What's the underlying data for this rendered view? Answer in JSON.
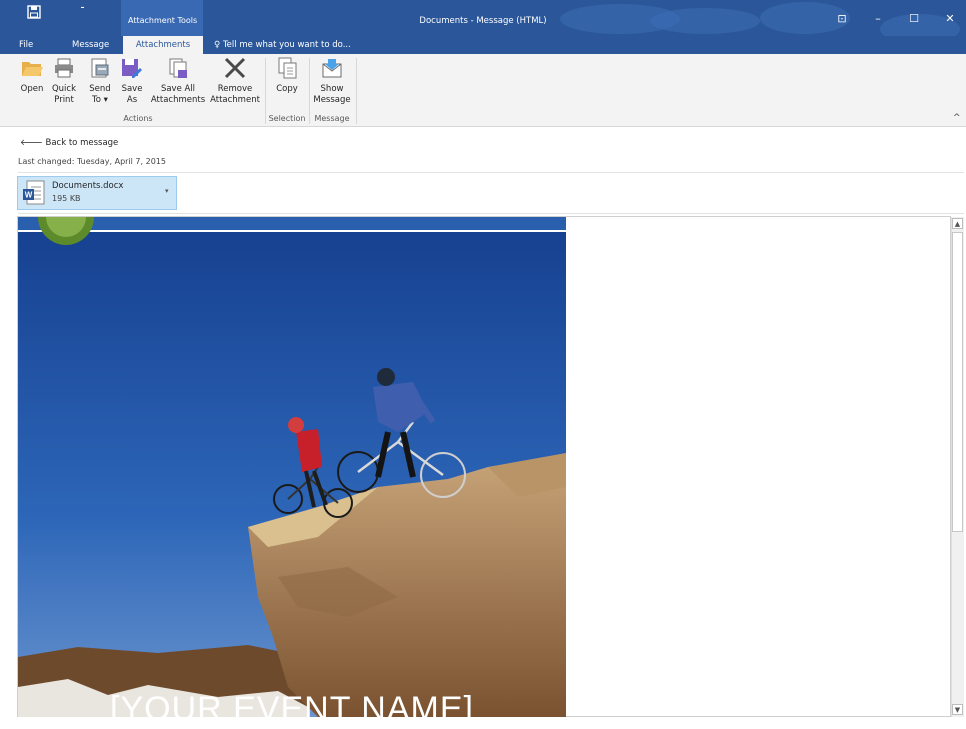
{
  "window": {
    "title": "Documents - Message (HTML)",
    "context_tab_group": "Attachment Tools",
    "qat_more": "⁃",
    "buttons": {
      "ribbon_options": "⊡",
      "minimize": "–",
      "maximize": "☐",
      "close": "✕"
    }
  },
  "tabs": [
    {
      "label": "File"
    },
    {
      "label": "Message"
    },
    {
      "label": "Attachments",
      "selected": true
    }
  ],
  "tell_me": "Tell me what you want to do...",
  "ribbon": {
    "open": "Open",
    "quick_print": [
      "Quick",
      "Print"
    ],
    "send_to": [
      "Send",
      "To ▾"
    ],
    "save_as": [
      "Save",
      "As"
    ],
    "save_all": [
      "Save All",
      "Attachments"
    ],
    "remove": [
      "Remove",
      "Attachment"
    ],
    "copy": "Copy",
    "show_message": [
      "Show",
      "Message"
    ],
    "groups": {
      "actions": "Actions",
      "selection": "Selection",
      "message": "Message"
    },
    "collapse": "^"
  },
  "reading": {
    "back_link": "Back to message",
    "last_changed": "Last changed:   Tuesday, April 7, 2015"
  },
  "attachment": {
    "name": "Documents.docx",
    "size": "195 KB",
    "caret": "▾"
  },
  "preview": {
    "event_name": "[YOUR EVENT NAME]"
  },
  "scrollbar": {
    "up": "▲",
    "down": "▼"
  },
  "colors": {
    "accent": "#2b579a",
    "chip": "#cde6f7",
    "sky": "#1f4f9e"
  }
}
